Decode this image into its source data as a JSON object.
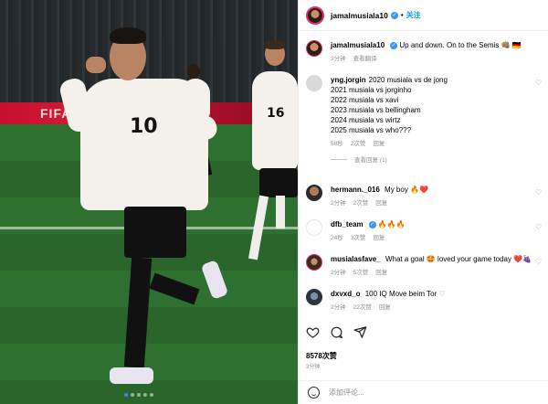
{
  "header": {
    "username": "jamalmusiala10",
    "verified": "✓",
    "sep": "•",
    "follow_label": "关注"
  },
  "photo": {
    "ad_text": "FIFA",
    "jersey_main": "10",
    "jersey_back": "16",
    "carousel_pages": 5,
    "carousel_current": 1
  },
  "caption": {
    "username": "jamalmusiala10",
    "text": "Up and down. On to the Semis 👊🏽 🇩🇪",
    "time": "3分钟",
    "translate": "查看翻译"
  },
  "comments": [
    {
      "username": "yng.jorgin",
      "lines": [
        "2020 musiala vs de jong",
        "2021 musiala vs jorginho",
        "2022 musiala vs xavi",
        "2023 musiala vs bellingham",
        "2024 musiala vs wirtz",
        "2025 musiala vs who???"
      ],
      "time": "58秒",
      "likes": "2次赞",
      "reply": "回复",
      "view_replies": "查看回复 (1)"
    },
    {
      "username": "hermann._016",
      "text": "My boy 🔥❤️",
      "time": "2分钟",
      "likes": "2次赞",
      "reply": "回复"
    },
    {
      "username": "dfb_team",
      "text": "🔥🔥🔥",
      "time": "24秒",
      "likes": "3次赞",
      "reply": "回复"
    },
    {
      "username": "musialasfave_",
      "text": "What a goal 🤩 loved your game today ❤️🍇",
      "time": "2分钟",
      "likes": "5次赞",
      "reply": "回复"
    },
    {
      "username": "dxvxd_o",
      "text": "100 IQ Move beim Tor",
      "time": "2分钟",
      "likes": "22次赞",
      "reply": "回复"
    }
  ],
  "footer": {
    "likes": "8578次赞",
    "time": "3分钟",
    "add_comment_placeholder": "添加评论..."
  },
  "colors": {
    "accent": "#0095f6",
    "verified": "#3897f0",
    "muted": "#8e8e8e"
  }
}
